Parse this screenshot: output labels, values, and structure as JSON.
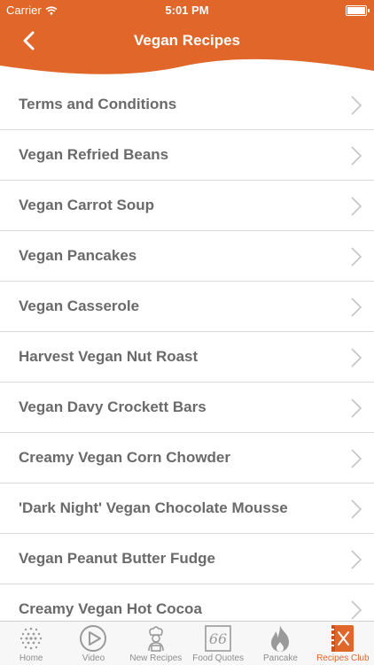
{
  "status_bar": {
    "carrier": "Carrier",
    "time": "5:01 PM"
  },
  "header": {
    "title": "Vegan Recipes"
  },
  "recipes": [
    "Terms and Conditions",
    "Vegan Refried Beans",
    "Vegan Carrot Soup",
    "Vegan Pancakes",
    "Vegan Casserole",
    "Harvest Vegan Nut Roast",
    "Vegan Davy Crockett Bars",
    "Creamy Vegan Corn Chowder",
    "'Dark Night' Vegan Chocolate Mousse",
    "Vegan Peanut Butter Fudge",
    "Creamy Vegan Hot Cocoa"
  ],
  "tabs": [
    {
      "label": "Home",
      "icon": "dots-grid-icon"
    },
    {
      "label": "Video",
      "icon": "play-icon"
    },
    {
      "label": "New Recipes",
      "icon": "chef-icon"
    },
    {
      "label": "Food Quotes",
      "icon": "quote-icon"
    },
    {
      "label": "Pancake",
      "icon": "flame-icon"
    },
    {
      "label": "Recipes Club",
      "icon": "recipe-book-icon",
      "active": true
    }
  ],
  "colors": {
    "accent": "#e0662a",
    "text": "#6a6a6a",
    "divider": "#d9d9d9"
  }
}
